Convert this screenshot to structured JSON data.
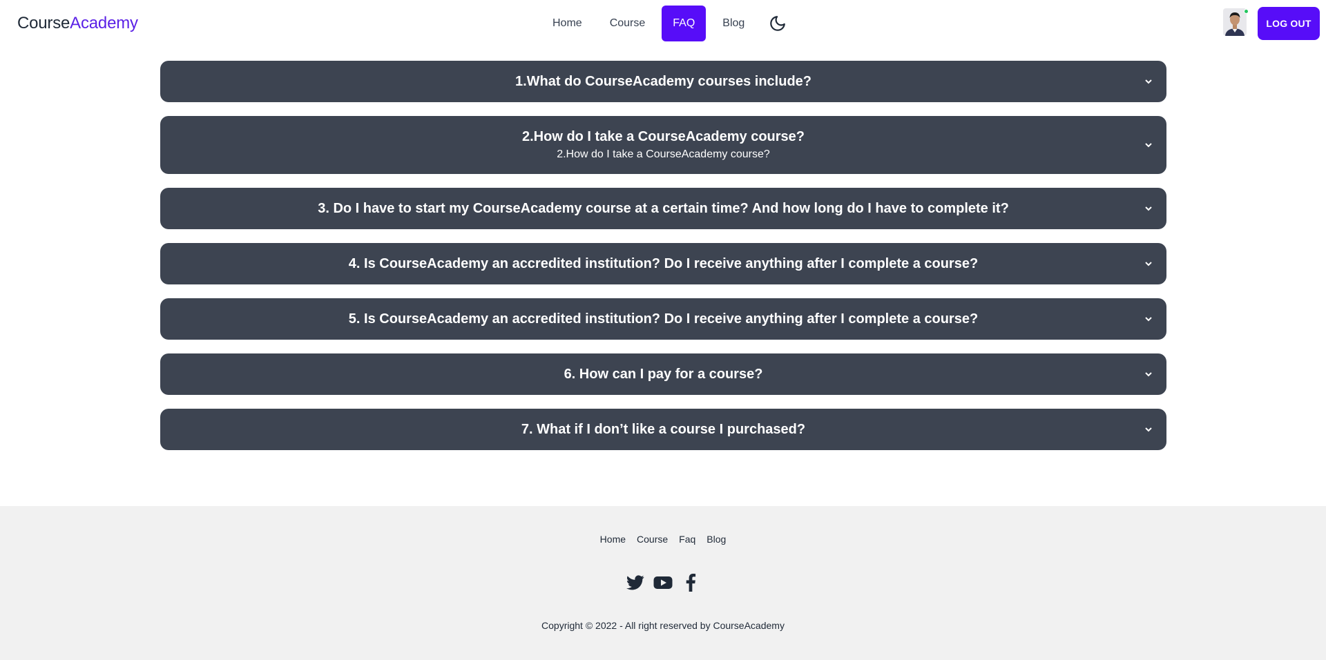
{
  "brand": {
    "part1": "Course",
    "part2": "Academy"
  },
  "nav": {
    "items": [
      {
        "label": "Home",
        "active": false
      },
      {
        "label": "Course",
        "active": false
      },
      {
        "label": "FAQ",
        "active": true
      },
      {
        "label": "Blog",
        "active": false
      }
    ],
    "theme_icon": "moon-icon",
    "logout_label": "LOG OUT"
  },
  "faq": {
    "items": [
      {
        "question": "1.What do CourseAcademy courses include?",
        "answer": ""
      },
      {
        "question": "2.How do I take a CourseAcademy course?",
        "answer": "2.How do I take a CourseAcademy course?"
      },
      {
        "question": "3. Do I have to start my CourseAcademy course at a certain time? And how long do I have to complete it?",
        "answer": ""
      },
      {
        "question": "4. Is CourseAcademy an accredited institution? Do I receive anything after I complete a course?",
        "answer": ""
      },
      {
        "question": "5. Is CourseAcademy an accredited institution? Do I receive anything after I complete a course?",
        "answer": ""
      },
      {
        "question": "6. How can I pay for a course?",
        "answer": ""
      },
      {
        "question": "7. What if I don’t like a course I purchased?",
        "answer": ""
      }
    ]
  },
  "footer": {
    "links": [
      "Home",
      "Course",
      "Faq",
      "Blog"
    ],
    "socials": [
      "twitter-icon",
      "youtube-icon",
      "facebook-icon"
    ],
    "copyright": "Copyright © 2022 - All right reserved by CourseAcademy"
  },
  "colors": {
    "accent": "#570df8",
    "brand_accent": "#5b21e6",
    "faq_bg": "#3d4451",
    "footer_bg": "#f1f1f1",
    "online": "#22c55e"
  }
}
